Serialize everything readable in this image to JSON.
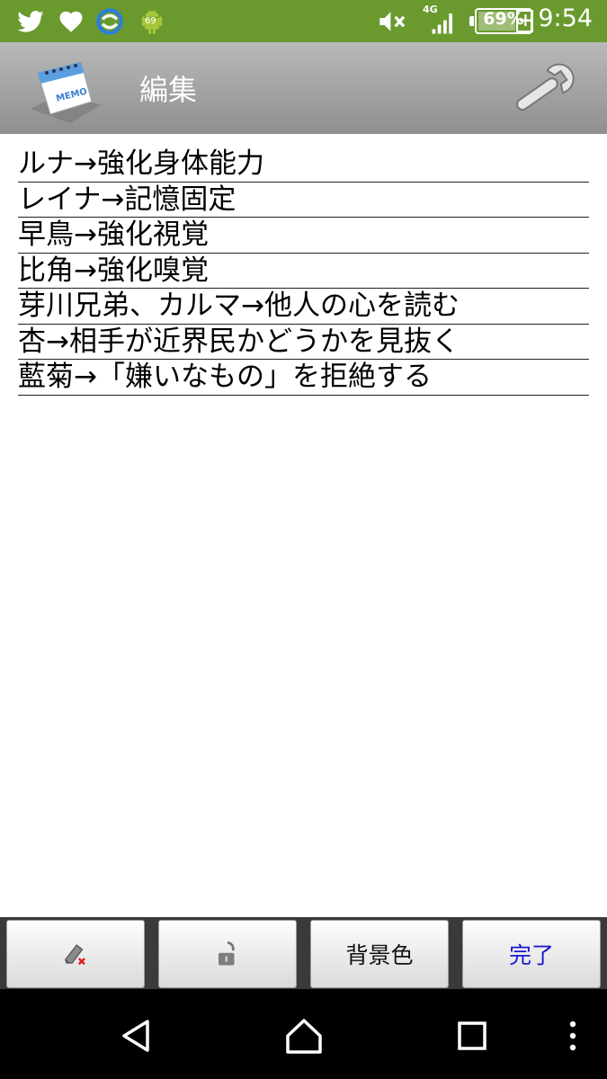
{
  "status_bar": {
    "time": "9:54",
    "battery_percent": "69%",
    "network": "4G",
    "icons": [
      "twitter-icon",
      "heart-icon",
      "sync-icon",
      "android-icon",
      "mute-icon",
      "signal-icon",
      "battery-icon",
      "charging-plus-icon"
    ],
    "notification_badge": "69"
  },
  "action_bar": {
    "title": "編集",
    "app_icon_label": "MEMO"
  },
  "memo": {
    "lines": [
      "ルナ→強化身体能力",
      "レイナ→記憶固定",
      "早鳥→強化視覚",
      "比角→強化嗅覚",
      "芽川兄弟、カルマ→他人の心を読む",
      "杏→相手が近界民かどうかを見抜く",
      "藍菊→「嫌いなもの」を拒絶する"
    ]
  },
  "toolbar": {
    "background_color_label": "背景色",
    "done_label": "完了"
  },
  "colors": {
    "status_bar": "#6a9a2e",
    "done_text": "#1a1ad0"
  }
}
